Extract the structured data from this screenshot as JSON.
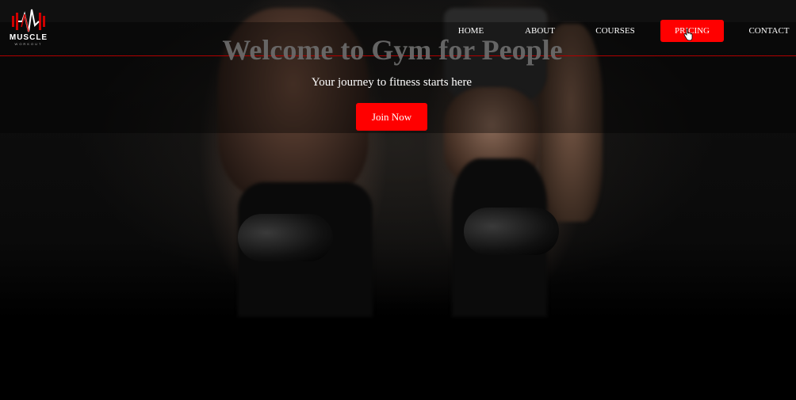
{
  "brand": {
    "name": "MUSCLE",
    "tagline": "WORKOUT"
  },
  "nav": {
    "items": [
      {
        "label": "HOME"
      },
      {
        "label": "ABOUT"
      },
      {
        "label": "COURSES"
      },
      {
        "label": "PRICING",
        "active": true
      },
      {
        "label": "CONTACT"
      }
    ]
  },
  "hero": {
    "title": "Welcome to Gym for People",
    "subtitle": "Your journey to fitness starts here",
    "cta_label": "Join Now"
  },
  "colors": {
    "accent": "#ff0000",
    "background": "#000000",
    "text": "#ffffff",
    "nav_divider": "#b00000"
  },
  "icons": {
    "logo": "heartbeat-muscle-logo-icon",
    "cursor": "hand-pointer-icon"
  }
}
